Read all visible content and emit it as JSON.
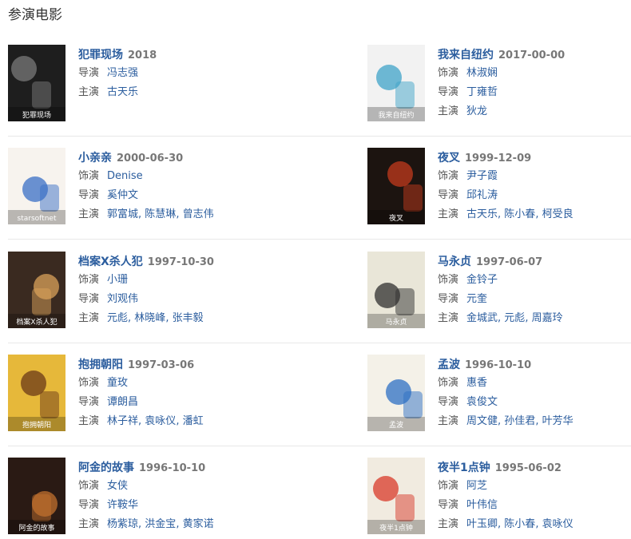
{
  "section_title": "参演电影",
  "movies": [
    {
      "title": "犯罪现场",
      "date": "2018",
      "poster": {
        "bg": "#1e1e1e",
        "accent": "#7a7a7a",
        "text": "犯罪现场"
      },
      "rows": [
        {
          "label": "导演",
          "values": [
            "冯志强"
          ]
        },
        {
          "label": "主演",
          "values": [
            "古天乐"
          ]
        }
      ]
    },
    {
      "title": "我来自纽约",
      "date": "2017-00-00",
      "poster": {
        "bg": "#f2f2f2",
        "accent": "#3fa3c8",
        "text": "我来自纽约"
      },
      "rows": [
        {
          "label": "饰演",
          "values": [
            "林淑娴"
          ]
        },
        {
          "label": "导演",
          "values": [
            "丁雍哲"
          ]
        },
        {
          "label": "主演",
          "values": [
            "狄龙"
          ]
        }
      ]
    },
    {
      "title": "小亲亲",
      "date": "2000-06-30",
      "poster": {
        "bg": "#f7f3ee",
        "accent": "#3a6fc6",
        "text": "starsoftnet"
      },
      "rows": [
        {
          "label": "饰演",
          "values": [
            "Denise"
          ]
        },
        {
          "label": "导演",
          "values": [
            "奚仲文"
          ]
        },
        {
          "label": "主演",
          "values": [
            "郭富城",
            "陈慧琳",
            "曾志伟"
          ]
        }
      ]
    },
    {
      "title": "夜叉",
      "date": "1999-12-09",
      "poster": {
        "bg": "#1c1410",
        "accent": "#c23a1c",
        "text": "夜叉"
      },
      "rows": [
        {
          "label": "饰演",
          "values": [
            "尹子霞"
          ]
        },
        {
          "label": "导演",
          "values": [
            "邱礼涛"
          ]
        },
        {
          "label": "主演",
          "values": [
            "古天乐",
            "陈小春",
            "柯受良"
          ]
        }
      ]
    },
    {
      "title": "档案X杀人犯",
      "date": "1997-10-30",
      "poster": {
        "bg": "#3a2a20",
        "accent": "#d9a15a",
        "text": "档案X杀人犯"
      },
      "rows": [
        {
          "label": "饰演",
          "values": [
            "小珊"
          ]
        },
        {
          "label": "导演",
          "values": [
            "刘观伟"
          ]
        },
        {
          "label": "主演",
          "values": [
            "元彪",
            "林晓峰",
            "张丰毅"
          ]
        }
      ]
    },
    {
      "title": "马永贞",
      "date": "1997-06-07",
      "poster": {
        "bg": "#e9e6d8",
        "accent": "#2f2f2f",
        "text": "马永贞"
      },
      "rows": [
        {
          "label": "饰演",
          "values": [
            "金铃子"
          ]
        },
        {
          "label": "导演",
          "values": [
            "元奎"
          ]
        },
        {
          "label": "主演",
          "values": [
            "金城武",
            "元彪",
            "周嘉玲"
          ]
        }
      ]
    },
    {
      "title": "抱拥朝阳",
      "date": "1997-03-06",
      "poster": {
        "bg": "#e6b83a",
        "accent": "#6b3a18",
        "text": "抱拥朝阳"
      },
      "rows": [
        {
          "label": "饰演",
          "values": [
            "童玫"
          ]
        },
        {
          "label": "导演",
          "values": [
            "谭朗昌"
          ]
        },
        {
          "label": "主演",
          "values": [
            "林子祥",
            "袁咏仪",
            "潘虹"
          ]
        }
      ]
    },
    {
      "title": "孟波",
      "date": "1996-10-10",
      "poster": {
        "bg": "#f4f1e8",
        "accent": "#2d6fc4",
        "text": "孟波"
      },
      "rows": [
        {
          "label": "饰演",
          "values": [
            "惠香"
          ]
        },
        {
          "label": "导演",
          "values": [
            "袁俊文"
          ]
        },
        {
          "label": "主演",
          "values": [
            "周文健",
            "孙佳君",
            "叶芳华"
          ]
        }
      ]
    },
    {
      "title": "阿金的故事",
      "date": "1996-10-10",
      "poster": {
        "bg": "#2a1a14",
        "accent": "#c2702e",
        "text": "阿金的故事"
      },
      "rows": [
        {
          "label": "饰演",
          "values": [
            "女侠"
          ]
        },
        {
          "label": "导演",
          "values": [
            "许鞍华"
          ]
        },
        {
          "label": "主演",
          "values": [
            "杨紫琼",
            "洪金宝",
            "黄家诺"
          ]
        }
      ]
    },
    {
      "title": "夜半1点钟",
      "date": "1995-06-02",
      "poster": {
        "bg": "#f1ebe0",
        "accent": "#d83a2a",
        "text": "夜半1点钟"
      },
      "rows": [
        {
          "label": "饰演",
          "values": [
            "阿芝"
          ]
        },
        {
          "label": "导演",
          "values": [
            "叶伟信"
          ]
        },
        {
          "label": "主演",
          "values": [
            "叶玉卿",
            "陈小春",
            "袁咏仪"
          ]
        }
      ]
    }
  ]
}
